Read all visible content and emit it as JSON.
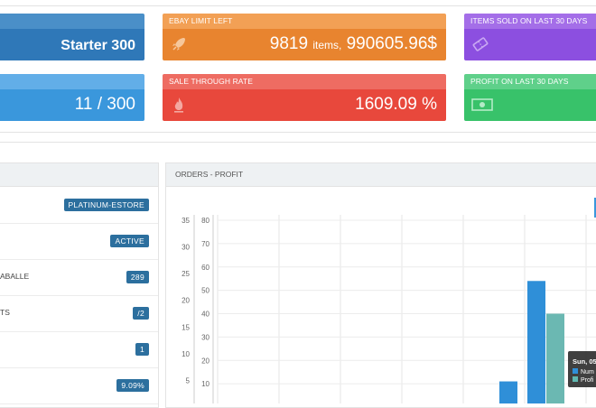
{
  "cards": [
    {
      "id": "plan",
      "head": "",
      "value": "Starter 300",
      "value_suffix": "",
      "head_color": "#4a8fc8",
      "body_color": "#2f78b8",
      "icon": "none"
    },
    {
      "id": "ebay-limit",
      "head": "EBAY LIMIT LEFT",
      "value": "9819",
      "value_small": "items,",
      "value_suffix": "990605.96$",
      "head_color": "#f2a055",
      "body_color": "#e8842f",
      "icon": "rocket-icon"
    },
    {
      "id": "items-sold",
      "head": "ITEMS SOLD ON LAST 30 DAYS",
      "value": "",
      "head_color": "#a46ee8",
      "body_color": "#8c4fe0",
      "icon": "ticket-icon"
    },
    {
      "id": "usage",
      "head": "",
      "value": "11 / 300",
      "head_color": "#62aee8",
      "body_color": "#3a97dc",
      "icon": "none"
    },
    {
      "id": "sale-through",
      "head": "SALE THROUGH RATE",
      "value": "1609.09 %",
      "head_color": "#ee6c62",
      "body_color": "#e8483c",
      "icon": "fire-icon"
    },
    {
      "id": "profit",
      "head": "PROFIT ON LAST 30 DAYS",
      "value": "",
      "head_color": "#5fd08a",
      "body_color": "#38c26a",
      "icon": "money-icon"
    }
  ],
  "left_panel": {
    "rows": [
      {
        "label": "",
        "badge": "PLATINUM-ESTORE"
      },
      {
        "label": "",
        "badge": "ACTIVE"
      },
      {
        "label": "ABALLE",
        "badge": "289"
      },
      {
        "label": "TS",
        "badge": "/2"
      },
      {
        "label": "",
        "badge": "1"
      },
      {
        "label": "",
        "badge": "9.09%"
      }
    ]
  },
  "chart_panel": {
    "title": "ORDERS - PROFIT",
    "tooltip": {
      "title": "Sun, 05",
      "line1": "Num",
      "line2": "Profi",
      "color1": "#2f8fd8",
      "color2": "#5fb8b0"
    }
  },
  "chart_data": {
    "type": "bar",
    "left_axis": {
      "ticks": [
        5,
        10,
        15,
        20,
        25,
        30,
        35
      ],
      "ylim": [
        0,
        35
      ]
    },
    "right_axis": {
      "ticks": [
        10,
        20,
        30,
        40,
        50,
        60,
        70,
        80
      ],
      "ylim": [
        0,
        80
      ]
    },
    "series": [
      {
        "color": "#2f8fd8",
        "axis": "right",
        "values": [
          {
            "slot": 4,
            "value": 11
          },
          {
            "slot": 5,
            "value": 54
          }
        ]
      },
      {
        "color": "#6bb8b2",
        "axis": "right",
        "values": [
          {
            "slot": 5,
            "value": 40
          }
        ]
      }
    ]
  }
}
